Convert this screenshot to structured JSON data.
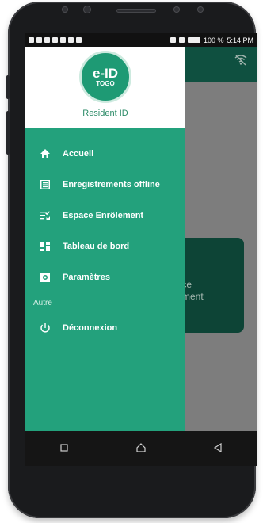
{
  "status_bar": {
    "battery": "100 %",
    "time": "5:14 PM"
  },
  "drawer": {
    "logo_main": "e-ID",
    "logo_sub": "TOGO",
    "header_title": "Resident ID",
    "items": [
      {
        "label": "Accueil",
        "icon": "home-icon"
      },
      {
        "label": "Enregistrements offline",
        "icon": "list-icon"
      },
      {
        "label": "Espace Enrôlement",
        "icon": "checklist-icon"
      },
      {
        "label": "Tableau de bord",
        "icon": "dashboard-icon"
      },
      {
        "label": "Paramètres",
        "icon": "settings-icon"
      }
    ],
    "section_other": "Autre",
    "logout": {
      "label": "Déconnexion",
      "icon": "power-icon"
    }
  },
  "background_card": {
    "line1": "space",
    "line2": "rôlement"
  },
  "colors": {
    "drawer": "#23a17c",
    "appbar": "#0f5040",
    "card": "#0d4436"
  }
}
